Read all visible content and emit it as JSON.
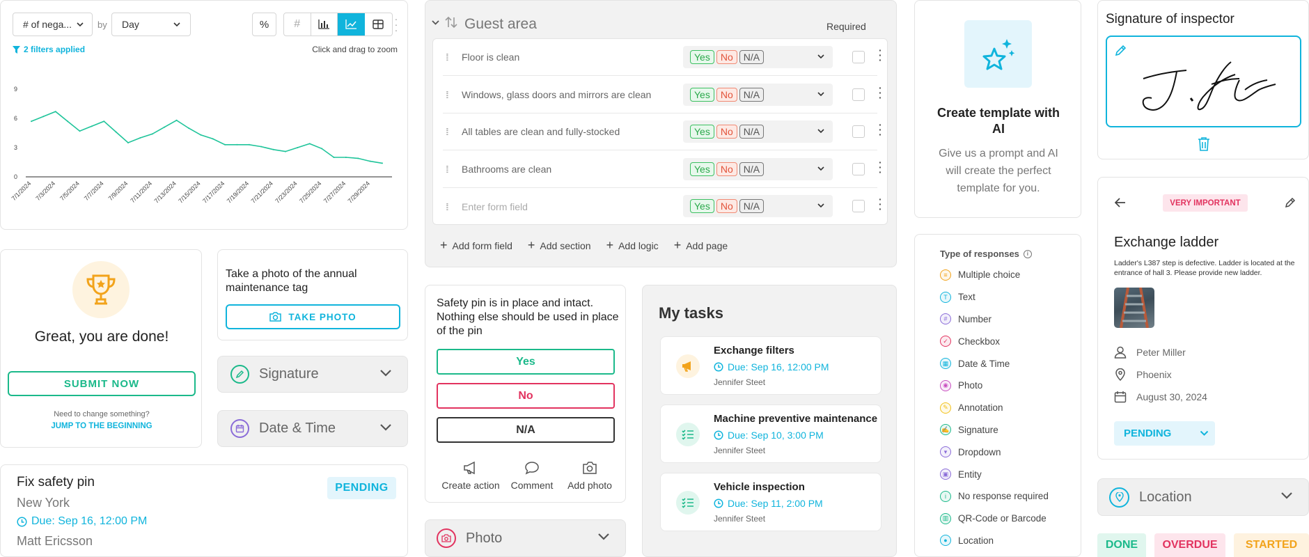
{
  "chart_card": {
    "metric_select": "# of nega...",
    "by_label": "by",
    "period_select": "Day",
    "filters_text": "2 filters applied",
    "zoom_hint": "Click and drag to zoom",
    "toolbar_icons": [
      "percent-icon",
      "hash-icon",
      "bar-chart-icon",
      "line-chart-icon",
      "table-icon",
      "more-vertical-icon"
    ]
  },
  "chart_data": {
    "type": "line",
    "x": [
      "7/1/2024",
      "7/2/2024",
      "7/3/2024",
      "7/4/2024",
      "7/5/2024",
      "7/6/2024",
      "7/7/2024",
      "7/8/2024",
      "7/9/2024",
      "7/10/2024",
      "7/11/2024",
      "7/12/2024",
      "7/13/2024",
      "7/14/2024",
      "7/15/2024",
      "7/16/2024",
      "7/17/2024",
      "7/18/2024",
      "7/19/2024",
      "7/20/2024",
      "7/21/2024",
      "7/22/2024",
      "7/23/2024",
      "7/24/2024",
      "7/25/2024",
      "7/26/2024",
      "7/27/2024",
      "7/28/2024",
      "7/29/2024",
      "7/30/2024"
    ],
    "tick_labels": [
      "7/1/2024",
      "7/3/2024",
      "7/5/2024",
      "7/7/2024",
      "7/9/2024",
      "7/11/2024",
      "7/13/2024",
      "7/15/2024",
      "7/17/2024",
      "7/19/2024",
      "7/21/2024",
      "7/23/2024",
      "7/25/2024",
      "7/27/2024",
      "7/29/2024"
    ],
    "series": [
      {
        "values": [
          5.7,
          6.2,
          6.7,
          5.7,
          4.7,
          5.2,
          5.7,
          4.6,
          3.5,
          4.0,
          4.4,
          5.1,
          5.8,
          5.0,
          4.3,
          3.9,
          3.3,
          3.3,
          3.3,
          3.1,
          2.8,
          2.6,
          3.0,
          3.4,
          2.9,
          2.0,
          2.0,
          1.9,
          1.6,
          1.4
        ],
        "color": "#1fc49a"
      }
    ],
    "ylim": [
      0,
      9.5
    ],
    "yticks": [
      0,
      3,
      6,
      9
    ],
    "grid": false
  },
  "done_card": {
    "title": "Great, you are done!",
    "submit_label": "SUBMIT NOW",
    "change_text": "Need to change something?",
    "jump_label": "JUMP TO THE BEGINNING"
  },
  "photo_tag": {
    "question": "Take a photo of the annual maintenance tag",
    "button_label": "TAKE PHOTO"
  },
  "signature_collapse": {
    "label": "Signature"
  },
  "datetime_collapse": {
    "label": "Date & Time"
  },
  "fix_card": {
    "title": "Fix safety pin",
    "status": "PENDING",
    "location": "New York",
    "due": "Due: Sep 16, 12:00 PM",
    "assignee": "Matt Ericsson"
  },
  "guest_area": {
    "title": "Guest area",
    "required_label": "Required",
    "fields": [
      {
        "label": "Floor is clean"
      },
      {
        "label": "Windows, glass doors and mirrors are clean"
      },
      {
        "label": "All tables are clean and fully-stocked"
      },
      {
        "label": "Bathrooms are clean"
      },
      {
        "placeholder": "Enter form field"
      }
    ],
    "yes": "Yes",
    "no": "No",
    "na": "N/A",
    "actions": {
      "add_field": "Add form field",
      "add_section": "Add section",
      "add_logic": "Add logic",
      "add_page": "Add page"
    }
  },
  "safety_q": {
    "question": "Safety pin is in place and intact. Nothing else should be used in place of the pin",
    "yes": "Yes",
    "no": "No",
    "na": "N/A",
    "create_action": "Create action",
    "comment": "Comment",
    "add_photo": "Add photo"
  },
  "photo_collapse": {
    "label": "Photo"
  },
  "my_tasks": {
    "title": "My tasks",
    "tasks": [
      {
        "title": "Exchange filters",
        "due": "Due: Sep 16, 12:00 PM",
        "user": "Jennifer Steet",
        "icon": "megaphone-icon",
        "icon_color": "#f2a31b"
      },
      {
        "title": "Machine preventive maintenance",
        "due": "Due: Sep 10, 3:00 PM",
        "user": "Jennifer Steet",
        "icon": "checklist-icon",
        "icon_color": "#1bb98a"
      },
      {
        "title": "Vehicle inspection",
        "due": "Due: Sep 11, 2:00 PM",
        "user": "Jennifer Steet",
        "icon": "checklist-icon",
        "icon_color": "#1bb98a"
      }
    ]
  },
  "ai_card": {
    "title": "Create template with AI",
    "description": "Give us a prompt and AI will create the perfect template for you."
  },
  "responses": {
    "title": "Type of responses",
    "items": [
      {
        "label": "Multiple choice",
        "color": "#f2a31b",
        "glyph": "≡"
      },
      {
        "label": "Text",
        "color": "#10b4dc",
        "glyph": "T"
      },
      {
        "label": "Number",
        "color": "#8a6bd8",
        "glyph": "#"
      },
      {
        "label": "Checkbox",
        "color": "#e2335f",
        "glyph": "✓"
      },
      {
        "label": "Date & Time",
        "color": "#10b4dc",
        "glyph": "▦"
      },
      {
        "label": "Photo",
        "color": "#c94fc0",
        "glyph": "◉"
      },
      {
        "label": "Annotation",
        "color": "#f2c21b",
        "glyph": "✎"
      },
      {
        "label": "Signature",
        "color": "#1bb98a",
        "glyph": "✍"
      },
      {
        "label": "Dropdown",
        "color": "#8a6bd8",
        "glyph": "▾"
      },
      {
        "label": "Entity",
        "color": "#8a6bd8",
        "glyph": "▣"
      },
      {
        "label": "No response required",
        "color": "#1bb98a",
        "glyph": "i"
      },
      {
        "label": "QR-Code or Barcode",
        "color": "#1bb98a",
        "glyph": "▥"
      },
      {
        "label": "Location",
        "color": "#10b4dc",
        "glyph": "●"
      }
    ]
  },
  "signature_card": {
    "title": "Signature of inspector"
  },
  "ladder_card": {
    "badge": "VERY IMPORTANT",
    "title": "Exchange ladder",
    "description": "Ladder's L387 step is defective. Ladder is located at the entrance of hall 3. Please provide new ladder.",
    "person": "Peter Miller",
    "city": "Phoenix",
    "date": "August 30, 2024",
    "status": "PENDING"
  },
  "location_collapse": {
    "label": "Location"
  },
  "status_chips": {
    "done": "DONE",
    "overdue": "OVERDUE",
    "started": "STARTED"
  }
}
